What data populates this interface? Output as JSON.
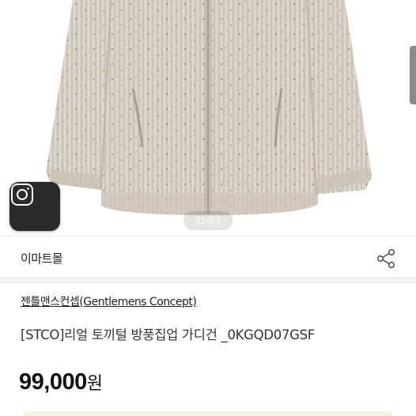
{
  "gallery": {
    "page_indicator": "01/03",
    "image_icon": "cardigan-photo",
    "camera_icon": "camera-icon"
  },
  "store": {
    "name": "이마트몰",
    "share_icon": "share-icon"
  },
  "product": {
    "brand": "젠틀맨스컨셉(Gentlemens Concept)",
    "title": "[STCO]리얼 토끼털 방풍집업 가디건 _0KGQD07GSF",
    "price_number": "99,000",
    "price_unit": "원"
  },
  "colors": {
    "knit": "#d8cfc4",
    "knit_shadow": "#b9aea1",
    "banner": "#f6f2e4"
  }
}
